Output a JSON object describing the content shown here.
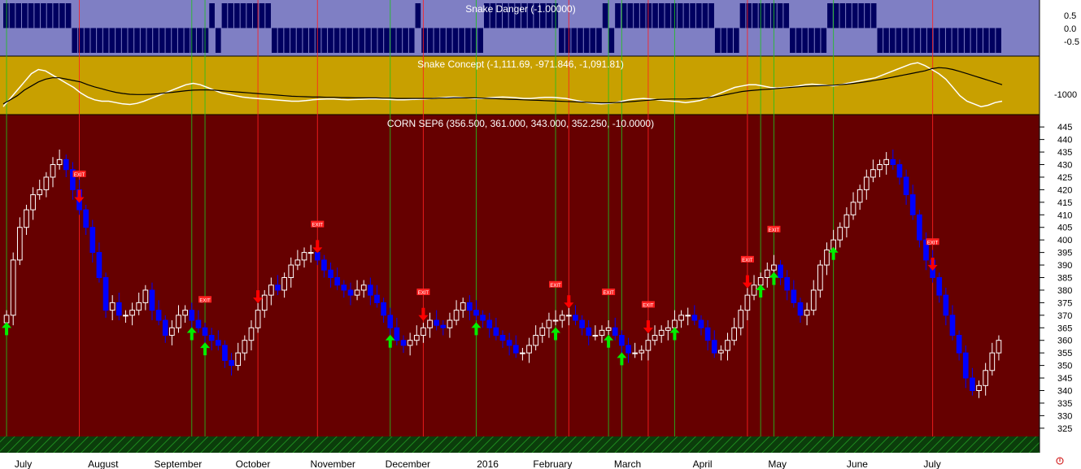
{
  "chart_data": [
    {
      "pane": "danger",
      "type": "bar",
      "title": "Snake Danger (-1.00000)",
      "ylim": [
        -1,
        1
      ],
      "yticks": [
        "0.5",
        "0.0",
        "-0.5"
      ],
      "colors": {
        "background": "#7f7fc4",
        "bars": "#000060"
      },
      "series": [
        {
          "values": [
            1,
            1,
            1,
            1,
            1,
            1,
            1,
            1,
            1,
            1,
            1,
            -1,
            -1,
            -1,
            -1,
            -1,
            -1,
            -1,
            -1,
            -1,
            -1,
            -1,
            -1,
            -1,
            -1,
            -1,
            -1,
            -1,
            -1,
            -1,
            -1,
            -1,
            -1,
            1,
            -1,
            1,
            1,
            1,
            1,
            1,
            1,
            1,
            1,
            -1,
            -1,
            -1,
            -1,
            -1,
            -1,
            -1,
            -1,
            -1,
            -1,
            -1,
            -1,
            -1,
            -1,
            -1,
            -1,
            -1,
            -1,
            -1,
            -1,
            -1,
            -1,
            -1,
            1,
            -1,
            -1,
            -1,
            -1,
            -1,
            -1,
            -1,
            -1,
            -1,
            -1,
            1,
            1,
            1,
            1,
            1,
            1,
            1,
            1,
            1,
            1,
            1,
            1,
            -1,
            -1,
            -1,
            -1,
            -1,
            -1,
            -1,
            1,
            -1,
            1,
            1,
            1,
            1,
            1,
            1,
            1,
            1,
            1,
            1,
            1,
            1,
            1,
            1,
            1,
            1,
            -1,
            -1,
            -1,
            -1,
            1,
            1,
            1,
            1,
            1,
            1,
            1,
            1,
            -1,
            -1,
            -1,
            -1,
            -1,
            -1,
            1,
            1,
            1,
            1,
            1,
            1,
            1,
            1,
            -1,
            -1,
            -1,
            -1,
            -1,
            -1,
            -1,
            -1,
            -1,
            -1,
            -1,
            -1,
            -1,
            -1,
            -1,
            -1,
            -1,
            -1,
            -1,
            -1
          ]
        }
      ]
    },
    {
      "pane": "concept",
      "type": "line",
      "title": "Snake Concept (-1,111.69, -971.846, -1,091.81)",
      "ylim": [
        -1130,
        -935
      ],
      "yticks": [
        "-1000"
      ],
      "colors": {
        "background": "#c8a000",
        "fast": "#ffffff",
        "slow": "#000000"
      },
      "series": [
        {
          "name": "fast",
          "values": [
            -1110,
            -1080,
            -1050,
            -1020,
            -990,
            -975,
            -980,
            -995,
            -1010,
            -1025,
            -1040,
            -1060,
            -1075,
            -1085,
            -1090,
            -1090,
            -1095,
            -1100,
            -1102,
            -1098,
            -1090,
            -1080,
            -1070,
            -1060,
            -1050,
            -1040,
            -1030,
            -1025,
            -1030,
            -1040,
            -1050,
            -1060,
            -1065,
            -1070,
            -1075,
            -1078,
            -1080,
            -1082,
            -1084,
            -1086,
            -1088,
            -1090,
            -1090,
            -1088,
            -1085,
            -1083,
            -1082,
            -1082,
            -1084,
            -1085,
            -1084,
            -1083,
            -1082,
            -1082,
            -1083,
            -1084,
            -1085,
            -1085,
            -1084,
            -1083,
            -1082,
            -1080,
            -1078,
            -1076,
            -1075,
            -1076,
            -1078,
            -1080,
            -1080,
            -1078,
            -1076,
            -1075,
            -1076,
            -1078,
            -1080,
            -1080,
            -1078,
            -1076,
            -1076,
            -1078,
            -1080,
            -1085,
            -1090,
            -1095,
            -1098,
            -1100,
            -1098,
            -1095,
            -1090,
            -1085,
            -1082,
            -1080,
            -1082,
            -1085,
            -1088,
            -1090,
            -1092,
            -1095,
            -1092,
            -1088,
            -1080,
            -1070,
            -1060,
            -1050,
            -1040,
            -1035,
            -1030,
            -1030,
            -1035,
            -1040,
            -1042,
            -1040,
            -1038,
            -1035,
            -1030,
            -1028,
            -1030,
            -1032,
            -1035,
            -1030,
            -1025,
            -1020,
            -1015,
            -1010,
            -1005,
            -995,
            -985,
            -975,
            -965,
            -955,
            -950,
            -960,
            -975,
            -990,
            -1010,
            -1040,
            -1070,
            -1090,
            -1100,
            -1110,
            -1105,
            -1095,
            -1090
          ]
        },
        {
          "name": "slow",
          "values": [
            -1100,
            -1085,
            -1070,
            -1050,
            -1035,
            -1020,
            -1010,
            -1005,
            -1005,
            -1010,
            -1015,
            -1020,
            -1030,
            -1038,
            -1045,
            -1052,
            -1058,
            -1062,
            -1065,
            -1066,
            -1066,
            -1065,
            -1063,
            -1060,
            -1058,
            -1055,
            -1052,
            -1050,
            -1049,
            -1049,
            -1050,
            -1052,
            -1054,
            -1056,
            -1058,
            -1060,
            -1062,
            -1064,
            -1066,
            -1068,
            -1070,
            -1072,
            -1073,
            -1074,
            -1075,
            -1075,
            -1076,
            -1076,
            -1077,
            -1077,
            -1078,
            -1078,
            -1078,
            -1078,
            -1079,
            -1079,
            -1080,
            -1080,
            -1080,
            -1080,
            -1080,
            -1080,
            -1079,
            -1079,
            -1078,
            -1078,
            -1078,
            -1078,
            -1079,
            -1080,
            -1081,
            -1082,
            -1083,
            -1084,
            -1085,
            -1086,
            -1087,
            -1088,
            -1089,
            -1090,
            -1091,
            -1092,
            -1093,
            -1094,
            -1095,
            -1096,
            -1096,
            -1095,
            -1094,
            -1092,
            -1090,
            -1088,
            -1086,
            -1084,
            -1083,
            -1082,
            -1082,
            -1082,
            -1081,
            -1080,
            -1078,
            -1075,
            -1070,
            -1065,
            -1060,
            -1055,
            -1052,
            -1050,
            -1048,
            -1046,
            -1044,
            -1042,
            -1040,
            -1038,
            -1036,
            -1035,
            -1034,
            -1033,
            -1032,
            -1030,
            -1028,
            -1025,
            -1022,
            -1018,
            -1014,
            -1010,
            -1005,
            -1000,
            -995,
            -990,
            -985,
            -980,
            -972,
            -968,
            -970,
            -975,
            -982,
            -990,
            -998,
            -1006,
            -1014,
            -1022,
            -1030
          ]
        }
      ]
    },
    {
      "pane": "price",
      "type": "candlestick",
      "title": "CORN SEP6 (356.500, 361.000, 343.000, 352.250, -10.0000)",
      "ylim": [
        323,
        447
      ],
      "yticks": [
        "445",
        "440",
        "435",
        "430",
        "425",
        "420",
        "415",
        "410",
        "405",
        "400",
        "395",
        "390",
        "385",
        "380",
        "375",
        "370",
        "365",
        "360",
        "355",
        "350",
        "345",
        "340",
        "335",
        "330",
        "325"
      ],
      "colors": {
        "background": "#660000",
        "up_candle": "#ffffff",
        "down_candle": "#0000ff",
        "buy_arrow": "#00ee00",
        "sell_arrow": "#ff0000",
        "exit_box": "#ff2020",
        "exit_box_green": "#00b000"
      },
      "closes": [
        370,
        392,
        405,
        412,
        418,
        420,
        425,
        430,
        432,
        428,
        420,
        412,
        405,
        395,
        385,
        372,
        375,
        370,
        370,
        372,
        375,
        380,
        372,
        368,
        362,
        365,
        370,
        372,
        368,
        365,
        362,
        360,
        358,
        352,
        350,
        355,
        360,
        365,
        372,
        378,
        382,
        380,
        385,
        390,
        392,
        395,
        395,
        392,
        388,
        385,
        382,
        380,
        378,
        380,
        382,
        378,
        375,
        370,
        365,
        360,
        358,
        360,
        362,
        365,
        368,
        366,
        365,
        368,
        372,
        375,
        372,
        370,
        368,
        365,
        362,
        360,
        358,
        355,
        355,
        358,
        362,
        365,
        368,
        368,
        370,
        370,
        368,
        365,
        362,
        362,
        364,
        365,
        362,
        358,
        355,
        355,
        356,
        360,
        362,
        364,
        365,
        368,
        370,
        370,
        368,
        365,
        360,
        355,
        356,
        360,
        365,
        372,
        378,
        382,
        385,
        388,
        390,
        385,
        380,
        375,
        370,
        372,
        380,
        390,
        396,
        400,
        405,
        410,
        415,
        420,
        425,
        428,
        430,
        432,
        430,
        425,
        418,
        410,
        400,
        392,
        385,
        378,
        370,
        362,
        355,
        345,
        340,
        342,
        348,
        355,
        360
      ],
      "exit_labels": [
        "EXIT",
        "EXIT",
        "EXIT",
        "EXIT",
        "EXIT",
        "EXIT",
        "EXIT",
        "EXIT",
        "EXIT",
        "EXIT",
        "EXIT",
        "EXIT",
        "EXIT"
      ],
      "signals": [
        {
          "i": 0,
          "type": "buy"
        },
        {
          "i": 11,
          "type": "sell"
        },
        {
          "i": 28,
          "type": "buy"
        },
        {
          "i": 30,
          "type": "buy"
        },
        {
          "i": 38,
          "type": "sell"
        },
        {
          "i": 47,
          "type": "sell"
        },
        {
          "i": 58,
          "type": "buy"
        },
        {
          "i": 63,
          "type": "sell"
        },
        {
          "i": 71,
          "type": "buy"
        },
        {
          "i": 83,
          "type": "buy"
        },
        {
          "i": 85,
          "type": "sell"
        },
        {
          "i": 91,
          "type": "buy"
        },
        {
          "i": 93,
          "type": "buy"
        },
        {
          "i": 97,
          "type": "sell"
        },
        {
          "i": 101,
          "type": "buy"
        },
        {
          "i": 112,
          "type": "sell"
        },
        {
          "i": 114,
          "type": "buy"
        },
        {
          "i": 116,
          "type": "buy"
        },
        {
          "i": 125,
          "type": "buy"
        },
        {
          "i": 140,
          "type": "sell"
        }
      ]
    }
  ],
  "months": [
    "July",
    "August",
    "September",
    "October",
    "November",
    "December",
    "2016",
    "February",
    "March",
    "April",
    "May",
    "June",
    "July"
  ],
  "footer_icon": "warning-icon"
}
